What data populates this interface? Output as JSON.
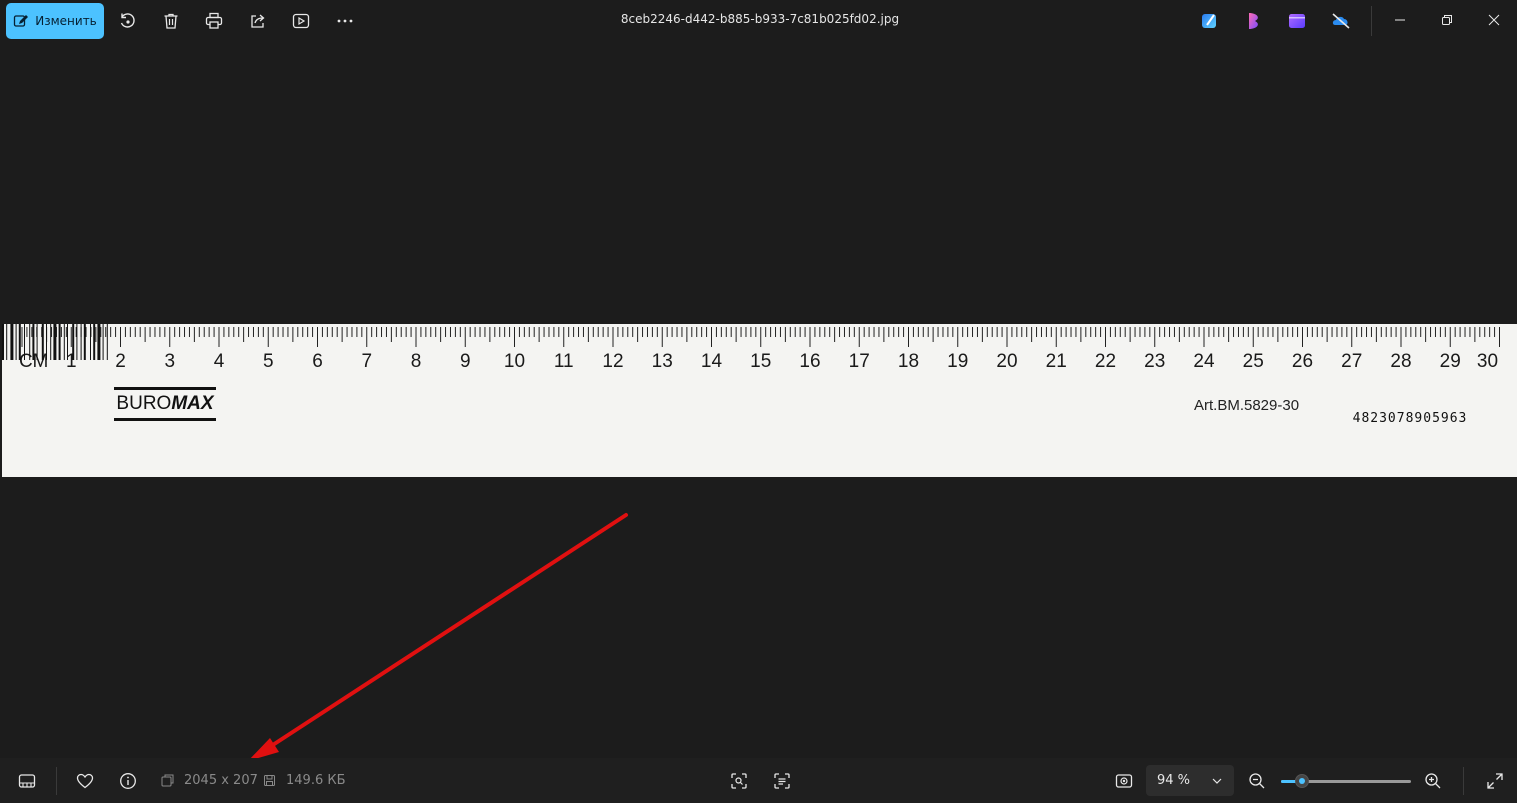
{
  "toolbar": {
    "edit_label": "Изменить"
  },
  "file_title": "8ceb2246-d442-b885-b933-7c81b025fd02.jpg",
  "ruler": {
    "unit_label": "СМ",
    "numbers": [
      "1",
      "2",
      "3",
      "4",
      "5",
      "6",
      "7",
      "8",
      "9",
      "10",
      "11",
      "12",
      "13",
      "14",
      "15",
      "16",
      "17",
      "18",
      "19",
      "20",
      "21",
      "22",
      "23",
      "24",
      "25",
      "26",
      "27",
      "28",
      "29",
      "30"
    ],
    "brand_part1": "BURO",
    "brand_part2": "MAX",
    "article": "Art.BM.5829-30",
    "barcode_number": "4823078905963"
  },
  "statusbar": {
    "dimensions": "2045 x 207",
    "file_size": "149.6 КБ",
    "zoom": "94 %",
    "zoom_level": 0.165
  },
  "colors": {
    "accent": "#4cc2ff",
    "annotation": "#e01010",
    "background": "#1c1c1c"
  }
}
